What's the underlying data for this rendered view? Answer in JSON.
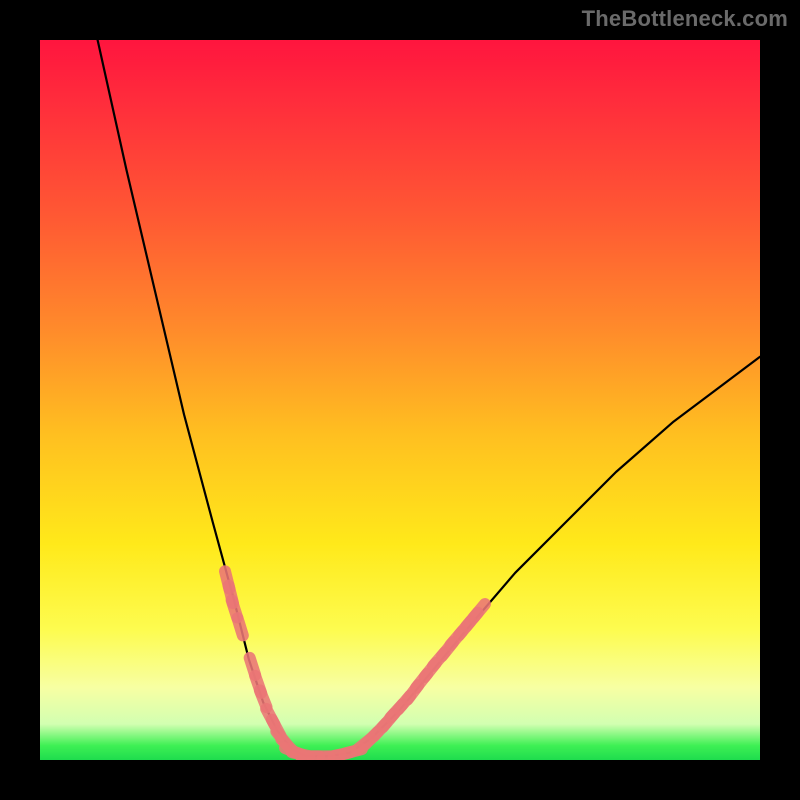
{
  "watermark": "TheBottleneck.com",
  "chart_data": {
    "type": "line",
    "title": "",
    "xlabel": "",
    "ylabel": "",
    "xlim": [
      0,
      100
    ],
    "ylim": [
      0,
      100
    ],
    "grid": false,
    "curve": [
      {
        "x": 8,
        "y": 100
      },
      {
        "x": 12,
        "y": 82
      },
      {
        "x": 16,
        "y": 65
      },
      {
        "x": 20,
        "y": 48
      },
      {
        "x": 24,
        "y": 33
      },
      {
        "x": 27,
        "y": 22
      },
      {
        "x": 29,
        "y": 14
      },
      {
        "x": 31,
        "y": 8
      },
      {
        "x": 33,
        "y": 4
      },
      {
        "x": 35,
        "y": 1.5
      },
      {
        "x": 37,
        "y": 0.5
      },
      {
        "x": 40,
        "y": 0.5
      },
      {
        "x": 43,
        "y": 1
      },
      {
        "x": 46,
        "y": 3
      },
      {
        "x": 50,
        "y": 7
      },
      {
        "x": 55,
        "y": 13
      },
      {
        "x": 60,
        "y": 19
      },
      {
        "x": 66,
        "y": 26
      },
      {
        "x": 73,
        "y": 33
      },
      {
        "x": 80,
        "y": 40
      },
      {
        "x": 88,
        "y": 47
      },
      {
        "x": 96,
        "y": 53
      },
      {
        "x": 100,
        "y": 56
      }
    ],
    "markers_left": [
      {
        "x": 26.0,
        "y": 25.0
      },
      {
        "x": 26.5,
        "y": 23.0
      },
      {
        "x": 27.0,
        "y": 21.0
      },
      {
        "x": 27.8,
        "y": 18.5
      },
      {
        "x": 29.5,
        "y": 13.0
      },
      {
        "x": 30.3,
        "y": 10.5
      },
      {
        "x": 31.0,
        "y": 8.5
      },
      {
        "x": 32.0,
        "y": 6.0
      },
      {
        "x": 32.8,
        "y": 4.5
      },
      {
        "x": 33.6,
        "y": 3.0
      },
      {
        "x": 34.4,
        "y": 2.0
      },
      {
        "x": 35.2,
        "y": 1.2
      },
      {
        "x": 36.2,
        "y": 0.8
      },
      {
        "x": 37.5,
        "y": 0.5
      },
      {
        "x": 39.0,
        "y": 0.5
      },
      {
        "x": 40.5,
        "y": 0.5
      },
      {
        "x": 42.0,
        "y": 0.8
      },
      {
        "x": 43.5,
        "y": 1.2
      }
    ],
    "markers_right": [
      {
        "x": 45.0,
        "y": 2.2
      },
      {
        "x": 46.0,
        "y": 3.0
      },
      {
        "x": 47.2,
        "y": 4.2
      },
      {
        "x": 48.4,
        "y": 5.5
      },
      {
        "x": 49.5,
        "y": 6.8
      },
      {
        "x": 50.6,
        "y": 8.0
      },
      {
        "x": 51.8,
        "y": 9.4
      },
      {
        "x": 53.0,
        "y": 11.0
      },
      {
        "x": 54.2,
        "y": 12.5
      },
      {
        "x": 55.4,
        "y": 14.0
      },
      {
        "x": 56.6,
        "y": 15.4
      },
      {
        "x": 57.8,
        "y": 16.9
      },
      {
        "x": 59.0,
        "y": 18.3
      },
      {
        "x": 60.0,
        "y": 19.5
      },
      {
        "x": 61.0,
        "y": 20.7
      }
    ],
    "marker_color": "#eb7676"
  }
}
